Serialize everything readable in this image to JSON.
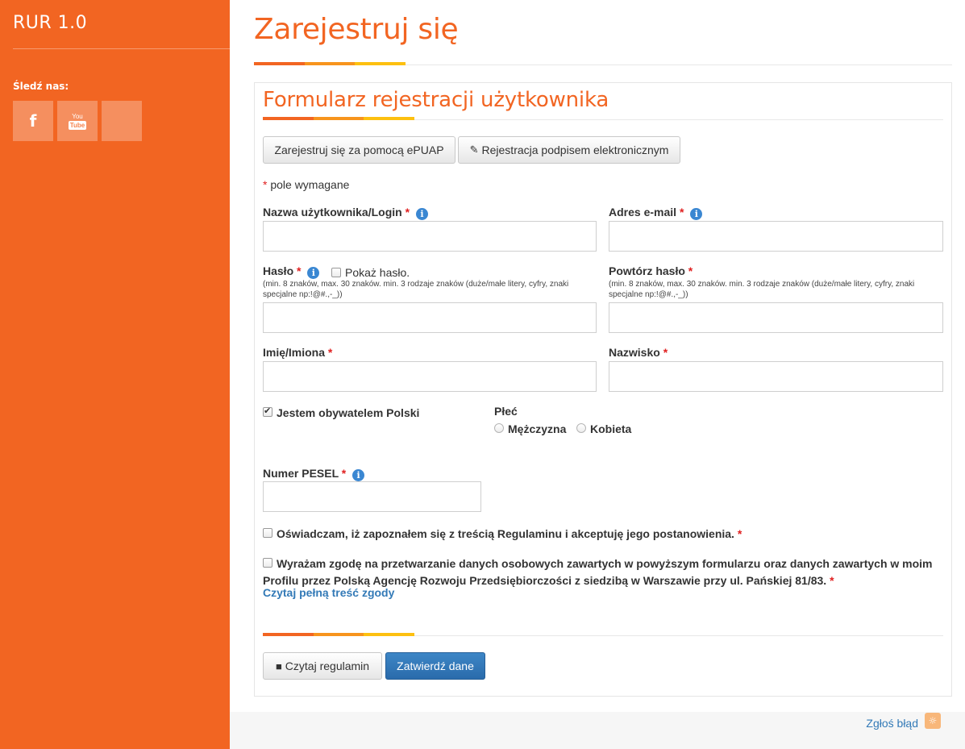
{
  "sidebar": {
    "brand": "RUR 1.0",
    "follow_label": "Śledź nas:",
    "social": {
      "facebook_glyph": "f",
      "youtube_top": "You",
      "youtube_bottom": "Tube"
    }
  },
  "header": {
    "title": "Zarejestruj się"
  },
  "form": {
    "title": "Formularz rejestracji użytkownika",
    "epuap_button": "Zarejestruj się za pomocą ePUAP",
    "esign_button": "Rejestracja podpisem elektronicznym",
    "required_star": "*",
    "required_note": " pole wymagane",
    "login_label": "Nazwa użytkownika/Login",
    "email_label": "Adres e-mail",
    "password_label": "Hasło",
    "show_password_label": "Pokaż hasło.",
    "password_hint": "(min. 8 znaków, max. 30 znaków. min. 3 rodzaje znaków (duże/małe litery, cyfry, znaki specjalne np:!@#.,-_))",
    "repeat_password_label": "Powtórz hasło",
    "repeat_password_hint": "(min. 8 znaków, max. 30 znaków. min. 3 rodzaje znaków (duże/małe litery, cyfry, znaki specjalne np:!@#.,-_))",
    "first_name_label": "Imię/Imiona",
    "last_name_label": "Nazwisko",
    "citizen_label": "Jestem obywatelem Polski",
    "citizen_checked": true,
    "gender_label": "Płeć",
    "gender_male": "Mężczyzna",
    "gender_female": "Kobieta",
    "pesel_label": "Numer PESEL",
    "terms_label": "Oświadczam, iż zapoznałem się z treścią Regulaminu i akceptuję jego postanowienia.",
    "consent_label": "Wyrażam zgodę na przetwarzanie danych osobowych zawartych w powyższym formularzu oraz danych zawartych w moim Profilu przez Polską Agencję Rozwoju Przedsiębiorczości z siedzibą w Warszawie przy ul. Pańskiej 81/83.",
    "consent_link": "Czytaj pełną treść zgody",
    "read_terms_button": "Czytaj regulamin",
    "submit_button": "Zatwierdź dane"
  },
  "footer": {
    "report_link": "Zgłoś błąd"
  },
  "colors": {
    "brand_orange": "#f26522",
    "stripe_mid": "#f7941d",
    "stripe_yellow": "#fdc010",
    "primary_blue": "#2a6bab",
    "info_blue": "#3a87d2",
    "required_red": "#e02020"
  },
  "icons": {
    "pencil": "pencil-icon",
    "book": "book-icon",
    "info": "info-icon",
    "bug": "bug-icon"
  }
}
